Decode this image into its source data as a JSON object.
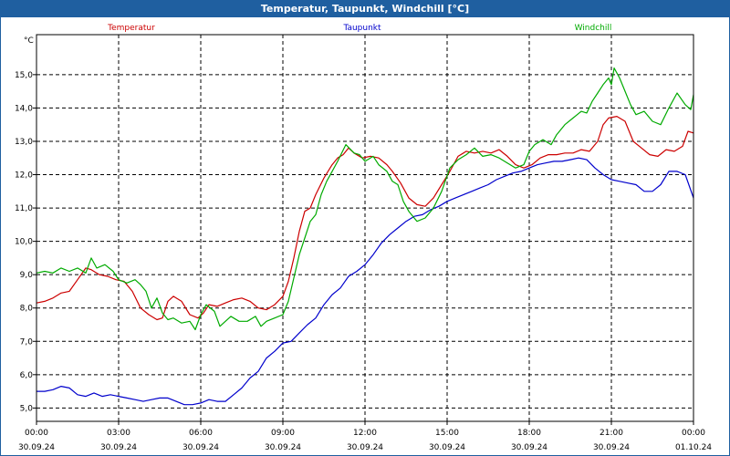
{
  "window": {
    "title": "Temperatur, Taupunkt, Windchill [°C]"
  },
  "chart_data": {
    "type": "line",
    "title": "Temperatur, Taupunkt, Windchill [°C]",
    "ylabel": "°C",
    "ylim": [
      4.6,
      16.2
    ],
    "yticks": [
      5.0,
      6.0,
      7.0,
      8.0,
      9.0,
      10.0,
      11.0,
      12.0,
      13.0,
      14.0,
      15.0
    ],
    "ytick_labels": [
      "5,0",
      "6,0",
      "7,0",
      "8,0",
      "9,0",
      "10,0",
      "11,0",
      "12,0",
      "13,0",
      "14,0",
      "15,0"
    ],
    "xlim": [
      0,
      24
    ],
    "xticks": [
      {
        "t": 0,
        "time": "00:00",
        "date": "30.09.24"
      },
      {
        "t": 3,
        "time": "03:00",
        "date": "30.09.24"
      },
      {
        "t": 6,
        "time": "06:00",
        "date": "30.09.24"
      },
      {
        "t": 9,
        "time": "09:00",
        "date": "30.09.24"
      },
      {
        "t": 12,
        "time": "12:00",
        "date": "30.09.24"
      },
      {
        "t": 15,
        "time": "15:00",
        "date": "30.09.24"
      },
      {
        "t": 18,
        "time": "18:00",
        "date": "30.09.24"
      },
      {
        "t": 21,
        "time": "21:00",
        "date": "30.09.24"
      },
      {
        "t": 24,
        "time": "00:00",
        "date": "01.10.24"
      }
    ],
    "grid": true,
    "legend_position": "top",
    "series": [
      {
        "name": "Temperatur",
        "color": "#cc0000",
        "points": [
          [
            0.0,
            8.15
          ],
          [
            0.3,
            8.2
          ],
          [
            0.6,
            8.3
          ],
          [
            0.9,
            8.45
          ],
          [
            1.2,
            8.5
          ],
          [
            1.5,
            8.85
          ],
          [
            1.8,
            9.2
          ],
          [
            2.0,
            9.15
          ],
          [
            2.3,
            9.0
          ],
          [
            2.6,
            8.95
          ],
          [
            2.9,
            8.85
          ],
          [
            3.2,
            8.8
          ],
          [
            3.5,
            8.5
          ],
          [
            3.8,
            8.0
          ],
          [
            4.1,
            7.8
          ],
          [
            4.4,
            7.65
          ],
          [
            4.6,
            7.7
          ],
          [
            4.8,
            8.2
          ],
          [
            5.0,
            8.35
          ],
          [
            5.3,
            8.2
          ],
          [
            5.6,
            7.8
          ],
          [
            5.9,
            7.7
          ],
          [
            6.1,
            7.85
          ],
          [
            6.3,
            8.1
          ],
          [
            6.6,
            8.05
          ],
          [
            6.9,
            8.15
          ],
          [
            7.2,
            8.25
          ],
          [
            7.5,
            8.3
          ],
          [
            7.8,
            8.2
          ],
          [
            8.1,
            8.0
          ],
          [
            8.4,
            7.95
          ],
          [
            8.7,
            8.1
          ],
          [
            9.0,
            8.35
          ],
          [
            9.2,
            8.8
          ],
          [
            9.4,
            9.5
          ],
          [
            9.6,
            10.3
          ],
          [
            9.8,
            10.9
          ],
          [
            10.0,
            11.0
          ],
          [
            10.2,
            11.4
          ],
          [
            10.5,
            11.9
          ],
          [
            10.8,
            12.3
          ],
          [
            11.0,
            12.5
          ],
          [
            11.2,
            12.6
          ],
          [
            11.4,
            12.8
          ],
          [
            11.6,
            12.65
          ],
          [
            11.9,
            12.5
          ],
          [
            12.2,
            12.55
          ],
          [
            12.5,
            12.5
          ],
          [
            12.8,
            12.3
          ],
          [
            13.0,
            12.1
          ],
          [
            13.3,
            11.75
          ],
          [
            13.6,
            11.3
          ],
          [
            13.9,
            11.1
          ],
          [
            14.2,
            11.05
          ],
          [
            14.5,
            11.3
          ],
          [
            14.8,
            11.7
          ],
          [
            15.1,
            12.1
          ],
          [
            15.4,
            12.55
          ],
          [
            15.7,
            12.7
          ],
          [
            16.0,
            12.65
          ],
          [
            16.3,
            12.7
          ],
          [
            16.6,
            12.65
          ],
          [
            16.9,
            12.75
          ],
          [
            17.2,
            12.55
          ],
          [
            17.5,
            12.3
          ],
          [
            17.8,
            12.2
          ],
          [
            18.1,
            12.3
          ],
          [
            18.4,
            12.5
          ],
          [
            18.7,
            12.6
          ],
          [
            19.0,
            12.6
          ],
          [
            19.3,
            12.65
          ],
          [
            19.6,
            12.65
          ],
          [
            19.9,
            12.75
          ],
          [
            20.2,
            12.7
          ],
          [
            20.5,
            13.0
          ],
          [
            20.7,
            13.5
          ],
          [
            20.9,
            13.7
          ],
          [
            21.2,
            13.75
          ],
          [
            21.5,
            13.6
          ],
          [
            21.8,
            13.0
          ],
          [
            22.1,
            12.8
          ],
          [
            22.4,
            12.6
          ],
          [
            22.7,
            12.55
          ],
          [
            23.0,
            12.75
          ],
          [
            23.3,
            12.7
          ],
          [
            23.6,
            12.85
          ],
          [
            23.8,
            13.3
          ],
          [
            24.0,
            13.25
          ]
        ]
      },
      {
        "name": "Taupunkt",
        "color": "#0000cc",
        "points": [
          [
            0.0,
            5.5
          ],
          [
            0.3,
            5.5
          ],
          [
            0.6,
            5.55
          ],
          [
            0.9,
            5.65
          ],
          [
            1.2,
            5.6
          ],
          [
            1.5,
            5.4
          ],
          [
            1.8,
            5.35
          ],
          [
            2.1,
            5.45
          ],
          [
            2.4,
            5.35
          ],
          [
            2.7,
            5.4
          ],
          [
            3.0,
            5.35
          ],
          [
            3.3,
            5.3
          ],
          [
            3.6,
            5.25
          ],
          [
            3.9,
            5.2
          ],
          [
            4.2,
            5.25
          ],
          [
            4.5,
            5.3
          ],
          [
            4.8,
            5.3
          ],
          [
            5.1,
            5.2
          ],
          [
            5.4,
            5.1
          ],
          [
            5.7,
            5.1
          ],
          [
            6.0,
            5.15
          ],
          [
            6.3,
            5.25
          ],
          [
            6.6,
            5.2
          ],
          [
            6.9,
            5.2
          ],
          [
            7.2,
            5.4
          ],
          [
            7.5,
            5.6
          ],
          [
            7.8,
            5.9
          ],
          [
            8.1,
            6.1
          ],
          [
            8.4,
            6.5
          ],
          [
            8.7,
            6.7
          ],
          [
            9.0,
            6.95
          ],
          [
            9.3,
            7.0
          ],
          [
            9.6,
            7.25
          ],
          [
            9.9,
            7.5
          ],
          [
            10.2,
            7.7
          ],
          [
            10.5,
            8.1
          ],
          [
            10.8,
            8.4
          ],
          [
            11.1,
            8.6
          ],
          [
            11.4,
            8.95
          ],
          [
            11.7,
            9.1
          ],
          [
            12.0,
            9.3
          ],
          [
            12.3,
            9.6
          ],
          [
            12.6,
            9.95
          ],
          [
            12.9,
            10.2
          ],
          [
            13.2,
            10.4
          ],
          [
            13.5,
            10.6
          ],
          [
            13.8,
            10.75
          ],
          [
            14.1,
            10.8
          ],
          [
            14.4,
            10.95
          ],
          [
            14.7,
            11.05
          ],
          [
            15.0,
            11.2
          ],
          [
            15.3,
            11.3
          ],
          [
            15.6,
            11.4
          ],
          [
            15.9,
            11.5
          ],
          [
            16.2,
            11.6
          ],
          [
            16.5,
            11.7
          ],
          [
            16.8,
            11.85
          ],
          [
            17.1,
            11.95
          ],
          [
            17.4,
            12.05
          ],
          [
            17.7,
            12.1
          ],
          [
            18.0,
            12.2
          ],
          [
            18.3,
            12.3
          ],
          [
            18.6,
            12.35
          ],
          [
            18.9,
            12.4
          ],
          [
            19.2,
            12.4
          ],
          [
            19.5,
            12.45
          ],
          [
            19.8,
            12.5
          ],
          [
            20.1,
            12.45
          ],
          [
            20.4,
            12.2
          ],
          [
            20.7,
            12.0
          ],
          [
            21.0,
            11.85
          ],
          [
            21.3,
            11.8
          ],
          [
            21.6,
            11.75
          ],
          [
            21.9,
            11.7
          ],
          [
            22.2,
            11.5
          ],
          [
            22.5,
            11.5
          ],
          [
            22.8,
            11.7
          ],
          [
            23.1,
            12.1
          ],
          [
            23.4,
            12.1
          ],
          [
            23.7,
            12.0
          ],
          [
            24.0,
            11.3
          ]
        ]
      },
      {
        "name": "Windchill",
        "color": "#00aa00",
        "points": [
          [
            0.0,
            9.05
          ],
          [
            0.3,
            9.1
          ],
          [
            0.6,
            9.05
          ],
          [
            0.9,
            9.2
          ],
          [
            1.2,
            9.1
          ],
          [
            1.5,
            9.2
          ],
          [
            1.8,
            9.05
          ],
          [
            2.0,
            9.5
          ],
          [
            2.2,
            9.2
          ],
          [
            2.5,
            9.3
          ],
          [
            2.8,
            9.1
          ],
          [
            3.0,
            8.85
          ],
          [
            3.3,
            8.75
          ],
          [
            3.6,
            8.85
          ],
          [
            3.8,
            8.7
          ],
          [
            4.0,
            8.5
          ],
          [
            4.2,
            8.0
          ],
          [
            4.4,
            8.3
          ],
          [
            4.6,
            7.85
          ],
          [
            4.8,
            7.65
          ],
          [
            5.0,
            7.7
          ],
          [
            5.3,
            7.55
          ],
          [
            5.6,
            7.6
          ],
          [
            5.8,
            7.35
          ],
          [
            6.0,
            7.8
          ],
          [
            6.2,
            8.1
          ],
          [
            6.5,
            7.9
          ],
          [
            6.7,
            7.45
          ],
          [
            6.9,
            7.6
          ],
          [
            7.1,
            7.75
          ],
          [
            7.4,
            7.6
          ],
          [
            7.7,
            7.6
          ],
          [
            8.0,
            7.75
          ],
          [
            8.2,
            7.45
          ],
          [
            8.4,
            7.6
          ],
          [
            8.7,
            7.7
          ],
          [
            9.0,
            7.8
          ],
          [
            9.2,
            8.2
          ],
          [
            9.4,
            8.9
          ],
          [
            9.6,
            9.6
          ],
          [
            9.8,
            10.1
          ],
          [
            10.0,
            10.6
          ],
          [
            10.2,
            10.8
          ],
          [
            10.4,
            11.4
          ],
          [
            10.6,
            11.8
          ],
          [
            10.8,
            12.1
          ],
          [
            11.0,
            12.4
          ],
          [
            11.3,
            12.9
          ],
          [
            11.6,
            12.65
          ],
          [
            11.8,
            12.6
          ],
          [
            12.0,
            12.4
          ],
          [
            12.3,
            12.55
          ],
          [
            12.5,
            12.3
          ],
          [
            12.8,
            12.1
          ],
          [
            13.0,
            11.8
          ],
          [
            13.2,
            11.7
          ],
          [
            13.4,
            11.2
          ],
          [
            13.6,
            10.9
          ],
          [
            13.9,
            10.6
          ],
          [
            14.2,
            10.7
          ],
          [
            14.5,
            11.0
          ],
          [
            14.8,
            11.5
          ],
          [
            15.1,
            12.2
          ],
          [
            15.4,
            12.45
          ],
          [
            15.7,
            12.6
          ],
          [
            16.0,
            12.8
          ],
          [
            16.3,
            12.55
          ],
          [
            16.6,
            12.6
          ],
          [
            16.9,
            12.5
          ],
          [
            17.2,
            12.35
          ],
          [
            17.5,
            12.2
          ],
          [
            17.8,
            12.3
          ],
          [
            18.0,
            12.7
          ],
          [
            18.2,
            12.9
          ],
          [
            18.5,
            13.05
          ],
          [
            18.8,
            12.9
          ],
          [
            19.0,
            13.2
          ],
          [
            19.3,
            13.5
          ],
          [
            19.6,
            13.7
          ],
          [
            19.9,
            13.9
          ],
          [
            20.1,
            13.85
          ],
          [
            20.3,
            14.2
          ],
          [
            20.5,
            14.45
          ],
          [
            20.7,
            14.7
          ],
          [
            20.9,
            14.9
          ],
          [
            21.0,
            14.7
          ],
          [
            21.1,
            15.2
          ],
          [
            21.3,
            14.9
          ],
          [
            21.5,
            14.5
          ],
          [
            21.7,
            14.1
          ],
          [
            21.9,
            13.8
          ],
          [
            22.2,
            13.9
          ],
          [
            22.5,
            13.6
          ],
          [
            22.8,
            13.5
          ],
          [
            23.1,
            14.0
          ],
          [
            23.4,
            14.45
          ],
          [
            23.7,
            14.1
          ],
          [
            23.9,
            13.95
          ],
          [
            24.0,
            14.4
          ]
        ]
      }
    ]
  }
}
